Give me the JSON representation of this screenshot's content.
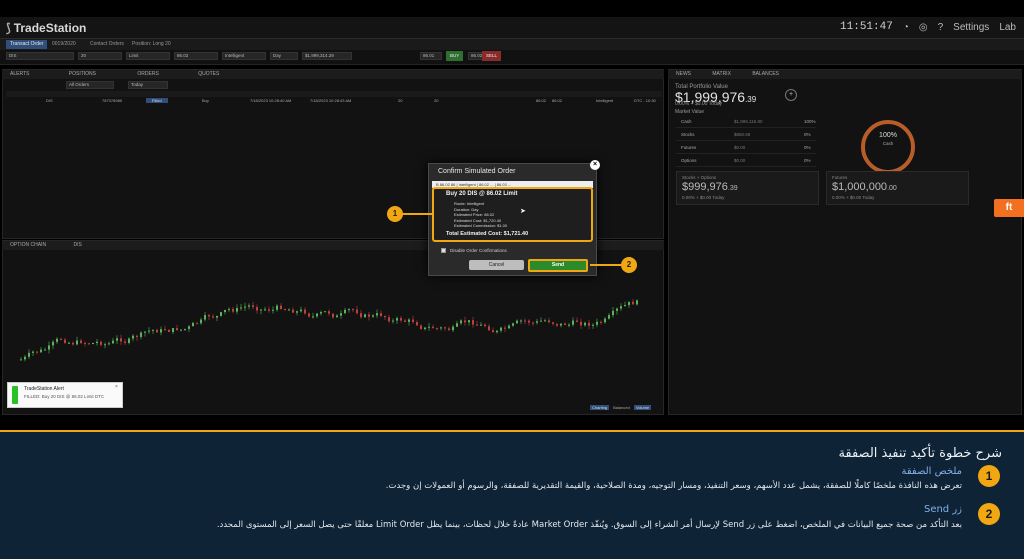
{
  "app": {
    "logo": "TradeStation",
    "clock": "11:51:47",
    "top_right_items": [
      "Settings",
      "Lab"
    ]
  },
  "tabs": {
    "transact": "Transact Order",
    "orders": "0019/2020",
    "open_orders": "Contact Orders",
    "position": "Position: Long 20"
  },
  "order_bar": {
    "symbol": "DIS",
    "qty": "20",
    "type": "Limit",
    "price": "86.02",
    "duration": "Intelligent",
    "route": "Day",
    "total": "$1,999,314.29",
    "bid": "86.01",
    "ask": "86.02",
    "buy_label": "BUY",
    "sell_label": "SELL"
  },
  "panels": {
    "left_tabs": [
      "ALERTS",
      "POSITIONS",
      "ORDERS",
      "QUOTES"
    ],
    "order_filter": "All Orders",
    "date_filter": "Today",
    "chart_title": "OPTION CHAIN",
    "chart_symbol": "DIS",
    "order_row": [
      "DIS",
      "787378985",
      "Filled",
      "Buy",
      "7/18/2023 10:28:40 AM",
      "7/18/2023 10:28:43 AM",
      "20",
      "20",
      "86.02",
      "86.02",
      "Intelligent",
      "DTC - 10:30"
    ],
    "chart_buttons": [
      "Charting",
      "Balanced",
      "Volume"
    ]
  },
  "right_panel": {
    "tabs": [
      "NEWS",
      "MATRIX",
      "BALANCES"
    ],
    "portfolio_label": "Total Portfolio Value",
    "portfolio_value": "$1,999,976",
    "portfolio_cents": ".39",
    "portfolio_change": "0.00%   + $0.00   Today",
    "market_value_label": "Market Value",
    "rows": [
      {
        "name": "Cash",
        "value": "$1,999,115.80",
        "pct": "100%"
      },
      {
        "name": "Stocks",
        "value": "$860.59",
        "pct": "0%"
      },
      {
        "name": "Futures",
        "value": "$0.00",
        "pct": "0%"
      },
      {
        "name": "Options",
        "value": "$0.00",
        "pct": "0%"
      }
    ],
    "ring_value": "100%",
    "ring_label": "Cash",
    "cards": [
      {
        "label": "Stocks + Options",
        "value": "$999,976",
        "cents": ".39",
        "change": "0.00% + $0.00 Today"
      },
      {
        "label": "Futures",
        "value": "$1,000,000",
        "cents": ".00",
        "change": "0.00% + $0.00 Today"
      }
    ]
  },
  "modal": {
    "title": "Confirm Simulated Order",
    "strip": "B  86.02  86  |  Intelligent  |  86.02  ...  |  86.03  ...",
    "headline": "Buy 20 DIS @ 86.02 Limit",
    "lines": [
      "Route: Intelligent",
      "Duration: Day",
      "Estimated Price: 86.02",
      "Estimated Cost: $1,720.40",
      "Estimated Commission: $1.00"
    ],
    "total": "Total Estimated Cost: $1,721.40",
    "checkbox_label": "Disable Order Confirmations",
    "cancel": "Cancel",
    "send": "Send",
    "callout_1": "1",
    "callout_2": "2"
  },
  "toast": {
    "title": "TradeStation Alert",
    "message": "FILLED: Buy 20 DIS @ 86.02 Limit DTC",
    "close": "×"
  },
  "side_fab": "ft",
  "explain": {
    "title": "شرح خطوة تأكيد تنفيذ الصفقة",
    "items": [
      {
        "badge": "1",
        "heading": "ملخص الصفقة",
        "body": "تعرض هذه النافذة ملخصًا كاملًا للصفقة، يشمل عدد الأسهم، وسعر التنفيذ، ومسار التوجيه، ومدة الصلاحية، والقيمة التقديرية للصفقة، والرسوم أو العمولات إن وجدت."
      },
      {
        "badge": "2",
        "heading": "زر Send",
        "body": "بعد التأكد من صحة جميع البيانات في الملخص، اضغط على زر Send لإرسال أمر الشراء إلى السوق. ويُنفّذ Market Order عادةً خلال لحظات، بينما يظل Limit Order معلقًا حتى يصل السعر إلى المستوى المحدد."
      }
    ]
  },
  "colors": {
    "accent": "#f0a712",
    "send_green": "#2b8a2b",
    "panel_bg": "#121212",
    "explain_bg": "#0f2336",
    "link_blue": "#7fb0ea",
    "candle_up": "#5bb35b",
    "candle_down": "#c04040"
  }
}
